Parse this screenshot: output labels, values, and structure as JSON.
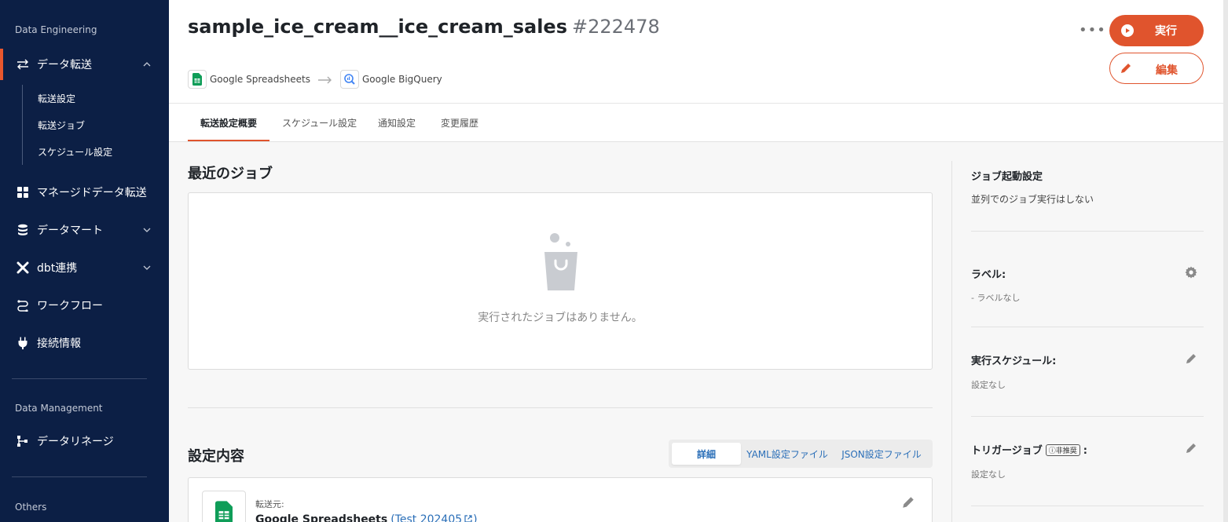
{
  "sidebar": {
    "section1": "Data Engineering",
    "section2": "Data Management",
    "section3": "Others",
    "items": [
      {
        "label": "データ転送"
      },
      {
        "label": "マネージドデータ転送"
      },
      {
        "label": "データマート"
      },
      {
        "label": "dbt連携"
      },
      {
        "label": "ワークフロー"
      },
      {
        "label": "接続情報"
      },
      {
        "label": "データリネージ"
      }
    ],
    "sub_items": [
      {
        "label": "転送設定"
      },
      {
        "label": "転送ジョブ"
      },
      {
        "label": "スケジュール設定"
      }
    ]
  },
  "header": {
    "title": "sample_ice_cream__ice_cream_sales",
    "job_id": "#222478",
    "source": "Google Spreadsheets",
    "destination": "Google BigQuery",
    "more": "•••",
    "run_label": "実行",
    "edit_label": "編集"
  },
  "tabs": [
    {
      "label": "転送設定概要"
    },
    {
      "label": "スケジュール設定"
    },
    {
      "label": "通知設定"
    },
    {
      "label": "変更履歴"
    }
  ],
  "main": {
    "recent_jobs_title": "最近のジョブ",
    "empty_message": "実行されたジョブはありません。",
    "settings_title": "設定内容",
    "segments": [
      {
        "label": "詳細"
      },
      {
        "label": "YAML設定ファイル"
      },
      {
        "label": "JSON設定ファイル"
      }
    ],
    "source_label": "転送元:",
    "source_name": "Google Spreadsheets",
    "source_link": "(Test 202405",
    "source_link_close": ")"
  },
  "right_panel": {
    "job_start_title": "ジョブ起動設定",
    "job_start_value": "並列でのジョブ実行はしない",
    "label_title": "ラベル:",
    "label_value": "- ラベルなし",
    "schedule_title": "実行スケジュール:",
    "schedule_value": "設定なし",
    "trigger_title": "トリガージョブ",
    "trigger_badge": "非推奨",
    "trigger_colon": ":",
    "trigger_value": "設定なし"
  },
  "colors": {
    "accent": "#e0542d",
    "sidebar_bg": "#0c1f45",
    "link": "#2b6fb8"
  }
}
